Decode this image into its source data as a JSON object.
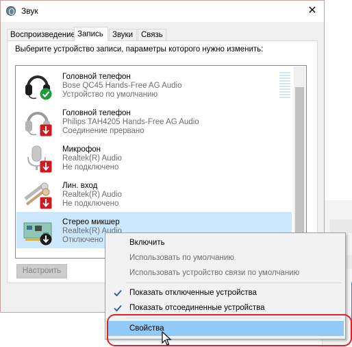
{
  "window": {
    "title": "Звук",
    "close_glyph": "✕"
  },
  "tabs": [
    {
      "label": "Воспроизведение",
      "active": false
    },
    {
      "label": "Запись",
      "active": true
    },
    {
      "label": "Звуки",
      "active": false
    },
    {
      "label": "Связь",
      "active": false
    }
  ],
  "prompt": "Выберите устройство записи, параметры которого нужно изменить:",
  "devices": [
    {
      "name": "Головной телефон",
      "description": "Bose QC45 Hands-Free AG Audio",
      "status": "Устройство по умолчанию",
      "icon": "headset-icon",
      "badge": "default-check-badge"
    },
    {
      "name": "Головной телефон",
      "description": "Philips TAH4205 Hands-Free AG Audio",
      "status": "Соединение прервано",
      "icon": "headset-icon",
      "badge": "disconnected-arrow-badge"
    },
    {
      "name": "Микрофон",
      "description": "Realtek(R) Audio",
      "status": "Не подключено",
      "icon": "microphone-icon",
      "badge": "disconnected-arrow-badge"
    },
    {
      "name": "Лин. вход",
      "description": "Realtek(R) Audio",
      "status": "Не подключено",
      "icon": "line-in-icon",
      "badge": "disconnected-arrow-badge"
    },
    {
      "name": "Стерео микшер",
      "description": "Realtek(R) Audio",
      "status": "Отключено",
      "icon": "sound-card-icon",
      "badge": "disabled-arrow-badge",
      "selected": true
    }
  ],
  "buttons": {
    "configure": "Настроить"
  },
  "context_menu": {
    "items": [
      {
        "label": "Включить",
        "enabled": true,
        "checked": false
      },
      {
        "label": "Использовать по умолчанию",
        "enabled": false,
        "checked": false
      },
      {
        "label": "Использовать устройство связи по умолчанию",
        "enabled": false,
        "checked": false
      },
      {
        "label": "Показать отключенные устройства",
        "enabled": true,
        "checked": true
      },
      {
        "label": "Показать отсоединенные устройства",
        "enabled": true,
        "checked": true
      },
      {
        "label": "Свойства",
        "enabled": true,
        "checked": false,
        "hovered": true
      }
    ]
  },
  "colors": {
    "selection": "#cce8ff",
    "menu_hover": "#91c9f7",
    "highlight": "#e0202a",
    "check": "#1a5fb4",
    "ok_badge": "#1e9b3a",
    "error_badge": "#d0191e"
  }
}
